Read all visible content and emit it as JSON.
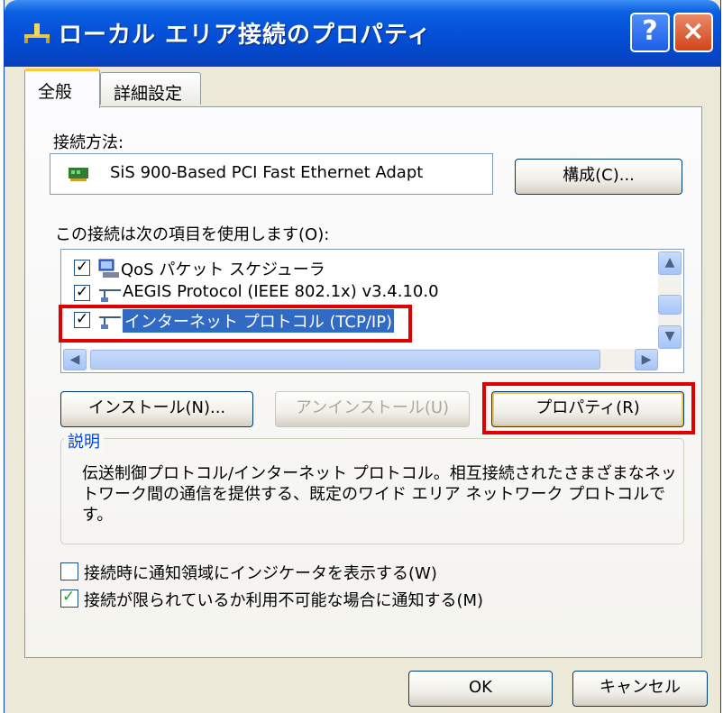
{
  "window": {
    "title": "ローカル エリア接続のプロパティ",
    "help_label": "?",
    "close_label": "×"
  },
  "tabs": [
    {
      "label": "全般",
      "active": true
    },
    {
      "label": "詳細設定",
      "active": false
    }
  ],
  "connection": {
    "label": "接続方法:",
    "adapter": "SiS 900-Based PCI Fast Ethernet Adapt",
    "configure_button": "構成(C)..."
  },
  "items": {
    "label": "この接続は次の項目を使用します(O):",
    "list": [
      {
        "name": "QoS パケット スケジューラ",
        "checked": true,
        "selected": false,
        "icon": "scheduler-icon"
      },
      {
        "name": "AEGIS Protocol (IEEE 802.1x) v3.4.10.0",
        "checked": true,
        "selected": false,
        "icon": "protocol-icon"
      },
      {
        "name": "インターネット プロトコル (TCP/IP)",
        "checked": true,
        "selected": true,
        "icon": "protocol-icon"
      }
    ]
  },
  "buttons": {
    "install": "インストール(N)...",
    "uninstall": "アンインストール(U)",
    "properties": "プロパティ(R)"
  },
  "description": {
    "title": "説明",
    "text": "伝送制御プロトコル/インターネット プロトコル。相互接続されたさまざまなネットワーク間の通信を提供する、既定のワイド エリア ネットワーク プロトコルです。"
  },
  "options": [
    {
      "label": "接続時に通知領域にインジケータを表示する(W)",
      "checked": false
    },
    {
      "label": "接続が限られているか利用不可能な場合に通知する(M)",
      "checked": true
    }
  ],
  "footer": {
    "ok": "OK",
    "cancel": "キャンセル"
  },
  "colors": {
    "titlebar": "#0550d8",
    "highlight": "#e00000",
    "selection": "#316ac5"
  }
}
